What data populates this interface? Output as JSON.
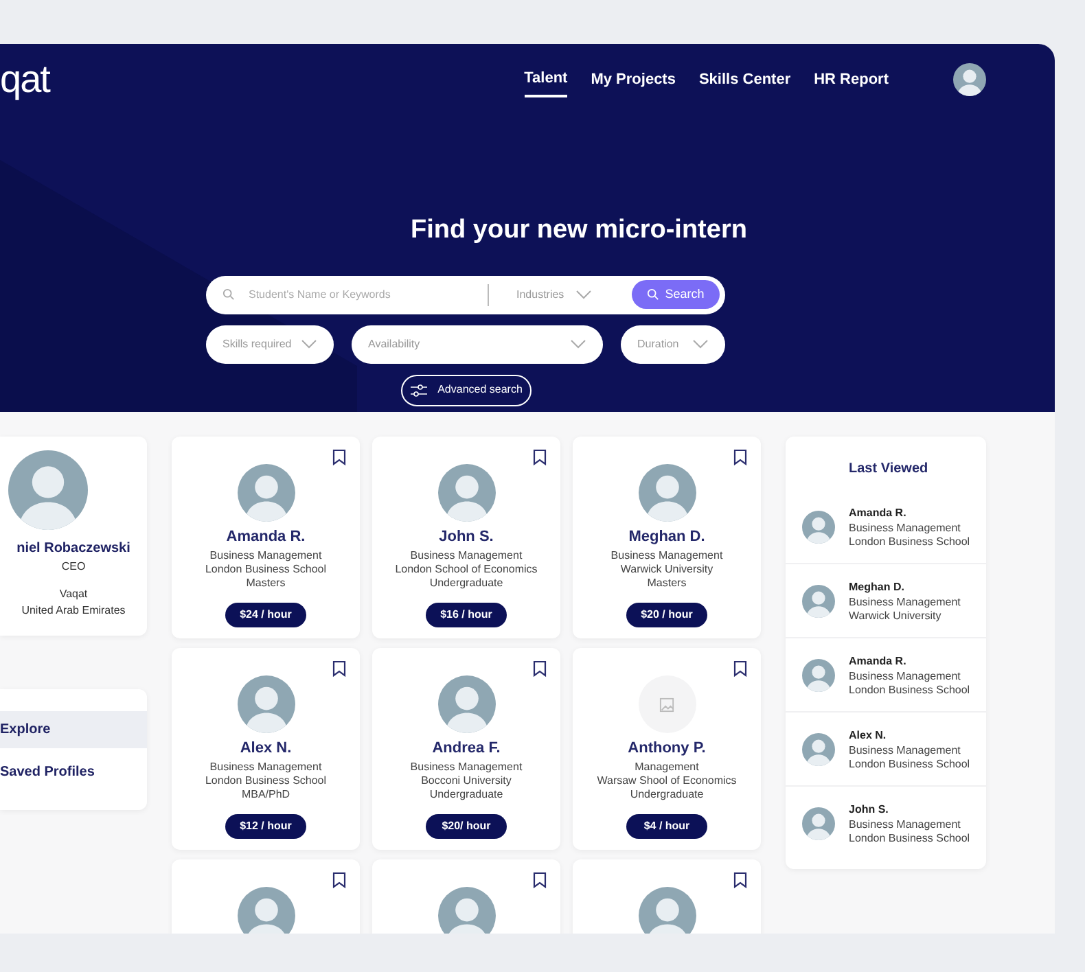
{
  "logo": "qat",
  "nav": [
    {
      "label": "Talent",
      "selected": true
    },
    {
      "label": "My Projects",
      "selected": false
    },
    {
      "label": "Skills Center",
      "selected": false
    },
    {
      "label": "HR Report",
      "selected": false
    }
  ],
  "hero": {
    "title": "Find your new micro-intern",
    "search": {
      "placeholder": "Student's Name or Keywords"
    },
    "industries": "Industries",
    "search_button": "Search",
    "filters": [
      "Skills required",
      "Availability",
      "Duration"
    ],
    "advanced_search": "Advanced search"
  },
  "profile": {
    "name": "niel Robaczewski",
    "role": "CEO",
    "company": "Vaqat",
    "country": "United Arab Emirates"
  },
  "side_menu": [
    {
      "label": "Explore",
      "selected": true
    },
    {
      "label": "Saved Profiles",
      "selected": false
    }
  ],
  "candidates": [
    {
      "name": "Amanda R.",
      "field": "Business Management",
      "school": "London Business School",
      "degree": "Masters",
      "rate": "$24 / hour",
      "photo": true
    },
    {
      "name": "John S.",
      "field": "Business Management",
      "school": "London School of Economics",
      "degree": "Undergraduate",
      "rate": "$16 / hour",
      "photo": true
    },
    {
      "name": "Meghan D.",
      "field": "Business Management",
      "school": "Warwick University",
      "degree": "Masters",
      "rate": "$20 / hour",
      "photo": true
    },
    {
      "name": "Alex N.",
      "field": "Business Management",
      "school": "London Business School",
      "degree": "MBA/PhD",
      "rate": "$12 / hour",
      "photo": true
    },
    {
      "name": "Andrea F.",
      "field": "Business Management",
      "school": "Bocconi University",
      "degree": "Undergraduate",
      "rate": "$20/ hour",
      "photo": true
    },
    {
      "name": "Anthony P.",
      "field": "Management",
      "school": "Warsaw Shool of Economics",
      "degree": "Undergraduate",
      "rate": "$4 / hour",
      "photo": false
    },
    {
      "photo": true
    },
    {
      "photo": true
    },
    {
      "photo": true
    }
  ],
  "last_viewed": {
    "title": "Last Viewed",
    "items": [
      {
        "name": "Amanda R.",
        "field": "Business Management",
        "school": "London Business School"
      },
      {
        "name": "Meghan D.",
        "field": "Business Management",
        "school": "Warwick University"
      },
      {
        "name": "Amanda R.",
        "field": "Business Management",
        "school": "London Business School"
      },
      {
        "name": "Alex N.",
        "field": "Business Management",
        "school": "London Business School"
      },
      {
        "name": "John S.",
        "field": "Business Management",
        "school": "London Business School"
      }
    ]
  }
}
